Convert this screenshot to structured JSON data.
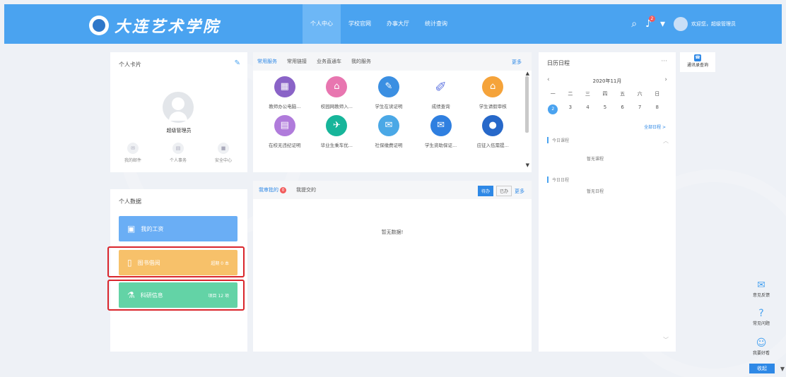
{
  "header": {
    "logo_text": "大连艺术学院",
    "nav": [
      "个人中心",
      "学校官网",
      "办事大厅",
      "统计查询"
    ],
    "bell_count": "2",
    "welcome": "欢迎您，超级管理员"
  },
  "personal_card": {
    "title": "个人卡片",
    "name": "超级管理员",
    "links": [
      {
        "label": "我的邮件",
        "icon": "mail-icon",
        "glyph": "✉"
      },
      {
        "label": "个人事务",
        "icon": "briefcase-icon",
        "glyph": "▤"
      },
      {
        "label": "安全中心",
        "icon": "lock-icon",
        "glyph": "🔒"
      }
    ]
  },
  "personal_data": {
    "title": "个人数据",
    "items": [
      {
        "label": "我的工资",
        "value": "",
        "color": "#6aaef5",
        "icon": "wallet-icon",
        "glyph": "▣"
      },
      {
        "label": "图书借阅",
        "value": "超期 0 本",
        "color": "#f7c16a",
        "icon": "book-icon",
        "glyph": "▯"
      },
      {
        "label": "科研信息",
        "value": "项目 12 项",
        "color": "#63d3a6",
        "icon": "flask-icon",
        "glyph": "⚗"
      }
    ]
  },
  "services": {
    "tabs": [
      "常用服务",
      "常用链接",
      "业务直通车",
      "我的服务"
    ],
    "more": "更多",
    "items": [
      {
        "label": "教师办公电脑...",
        "color": "#8a63c7",
        "icon": "office-computer-icon",
        "glyph": "▦"
      },
      {
        "label": "校园网教师入...",
        "color": "#e876b0",
        "icon": "campus-network-icon",
        "glyph": "⌂"
      },
      {
        "label": "学生在读证明",
        "color": "#3b8fe2",
        "icon": "student-certificate-icon",
        "glyph": "✎"
      },
      {
        "label": "成绩查询",
        "color": "#6b7fe3",
        "icon": "ruler-icon",
        "glyph": "✐"
      },
      {
        "label": "学生请假审核",
        "color": "#f5a33a",
        "icon": "leave-review-icon",
        "glyph": "⌂"
      },
      {
        "label": "在校无违纪证明",
        "color": "#b07bdb",
        "icon": "discipline-certificate-icon",
        "glyph": "▤"
      },
      {
        "label": "毕业生乘车优...",
        "color": "#17b59a",
        "icon": "graduate-travel-icon",
        "glyph": "✈"
      },
      {
        "label": "社保缴费证明",
        "color": "#4aa8e6",
        "icon": "social-security-icon",
        "glyph": "✉"
      },
      {
        "label": "学生资助保证...",
        "color": "#2f7fe0",
        "icon": "envelope-icon",
        "glyph": "✉"
      },
      {
        "label": "应征入伍需提...",
        "color": "#2768c9",
        "icon": "enlistment-icon",
        "glyph": "●"
      }
    ]
  },
  "todo": {
    "tabs": [
      {
        "label": "我审批的",
        "badge": "0"
      },
      {
        "label": "我提交的",
        "badge": ""
      }
    ],
    "chips": [
      "待办",
      "已办"
    ],
    "more": "更多",
    "empty": "暂无数据!"
  },
  "schedule": {
    "title": "日历日程",
    "dots": "···",
    "month": "2020年11月",
    "weekdays": [
      "一",
      "二",
      "三",
      "四",
      "五",
      "六",
      "日"
    ],
    "dates": [
      "2",
      "3",
      "4",
      "5",
      "6",
      "7",
      "8"
    ],
    "all_link": "全部日程 >",
    "today_label": "今日课程",
    "today_empty": "暂无课程",
    "today_sched_label": "今日日程",
    "today_sched_empty": "暂无日程"
  },
  "contacts": {
    "label": "通讯录查询"
  },
  "float": [
    {
      "label": "意见反馈",
      "icon": "feedback-icon",
      "glyph": "✉"
    },
    {
      "label": "常见问题",
      "icon": "faq-icon",
      "glyph": "?"
    },
    {
      "label": "我要好看",
      "icon": "rate-icon",
      "glyph": "☺"
    }
  ],
  "collapse_label": "收起"
}
